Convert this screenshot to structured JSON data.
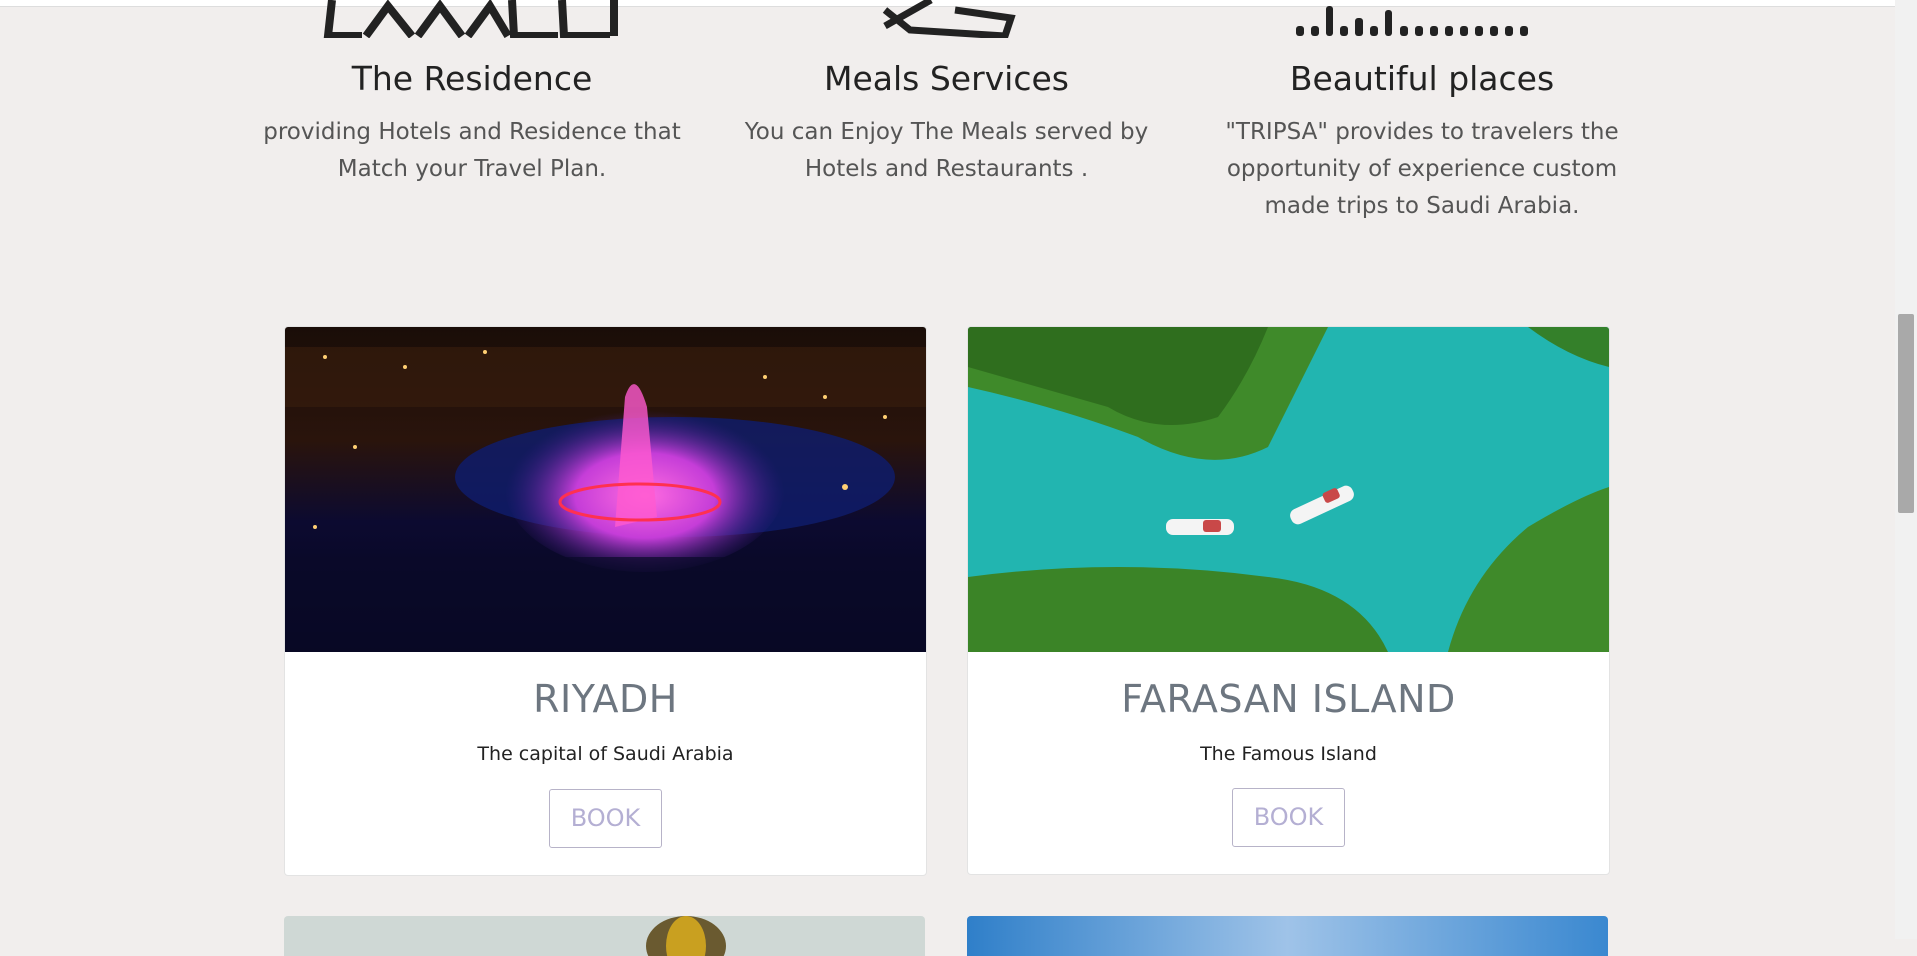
{
  "features": [
    {
      "icon": "building-icon",
      "title": "The Residence",
      "description": "providing Hotels and Residence that Match your Travel Plan."
    },
    {
      "icon": "cutlery-icon",
      "title": "Meals Services",
      "description": "You can Enjoy The Meals served by Hotels and Restaurants ."
    },
    {
      "icon": "skyline-icon",
      "title": "Beautiful places",
      "description": "\"TRIPSA\" provides to travelers the opportunity of experience custom made trips to Saudi Arabia."
    }
  ],
  "cards": [
    {
      "image": "riyadh-fountain-photo",
      "title": "RIYADH",
      "subtitle": "The capital of Saudi Arabia",
      "button": "BOOK"
    },
    {
      "image": "farasan-island-photo",
      "title": "FARASAN ISLAND",
      "subtitle": "The Famous Island",
      "button": "BOOK"
    }
  ],
  "colors": {
    "background": "#f1eeed",
    "card_title": "#6d7680",
    "button_text": "#b4afd3",
    "button_border": "#b7b3c8"
  }
}
